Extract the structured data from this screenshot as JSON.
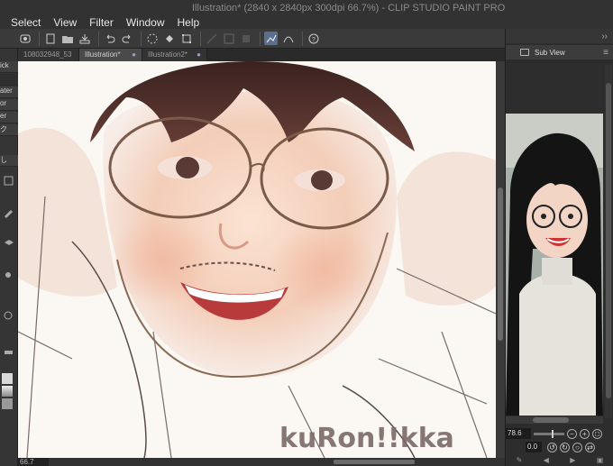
{
  "window": {
    "title": "Illustration* (2840 x 2840px 300dpi 66.7%) - CLIP STUDIO PAINT PRO"
  },
  "menu": {
    "items": [
      "Select",
      "View",
      "Filter",
      "Window",
      "Help"
    ]
  },
  "toolbar": {
    "icons": [
      "navigator-icon",
      "new-file-icon",
      "open-folder-icon",
      "save-icon",
      "undo-icon",
      "redo-icon",
      "loading-icon",
      "fill-icon",
      "transform-icon",
      "snap-ruler-icon",
      "snap-grid-icon",
      "snap-special-icon",
      "stroke-icon",
      "stroke-smooth-icon",
      "help-icon"
    ]
  },
  "tabs": [
    {
      "label": "108032948_53",
      "active": false
    },
    {
      "label": "Illustration*",
      "active": true
    },
    {
      "label": "Illustration2*",
      "active": false
    }
  ],
  "left_strip": {
    "labels": [
      "ick",
      "",
      "ater",
      "or",
      "er",
      "ク",
      "し"
    ]
  },
  "canvas": {
    "signature_text": "kuRon!!kka"
  },
  "statusbar": {
    "zoom": "66.7"
  },
  "right_panel": {
    "panel_title": "Sub View",
    "zoom_value": "78.6",
    "angle_value": "0.0",
    "colors": {
      "panel_bg": "#2d2d2d",
      "accent": "#5a6f8f"
    }
  }
}
